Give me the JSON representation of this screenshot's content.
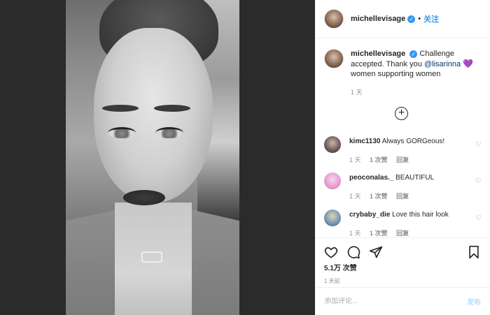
{
  "post": {
    "username": "michellevisage",
    "follow_label": "关注",
    "caption": {
      "username": "michellevisage",
      "text_before": "Challenge accepted. Thank you ",
      "mention": "@lisarinna",
      "heart": "💜",
      "text_after": "women supporting women",
      "time": "1 天"
    },
    "comments": [
      {
        "username": "kimc1130",
        "text": "Always GORGeous!",
        "time": "1 天",
        "likes": "1 次赞",
        "reply": "回复",
        "avatar_color": "#6b5a55"
      },
      {
        "username": "peoconalas._",
        "text": "BEAUTIFUL",
        "time": "1 天",
        "likes": "1 次赞",
        "reply": "回复",
        "avatar_color": "#e69ad0"
      },
      {
        "username": "crybaby_die",
        "text": "Love this hair look",
        "time": "1 天",
        "likes": "1 次赞",
        "reply": "回复",
        "avatar_color": "#7a9ab8"
      }
    ],
    "like_count": "5.1万 次赞",
    "posted_ago": "1 天前",
    "comment_placeholder": "添加评论...",
    "post_button": "发布"
  },
  "icons": {
    "like": "heart-outline-icon",
    "comment": "comment-bubble-icon",
    "share": "paper-plane-icon",
    "save": "bookmark-icon",
    "load_more": "plus-circle-icon",
    "verified": "verified-badge-icon"
  }
}
